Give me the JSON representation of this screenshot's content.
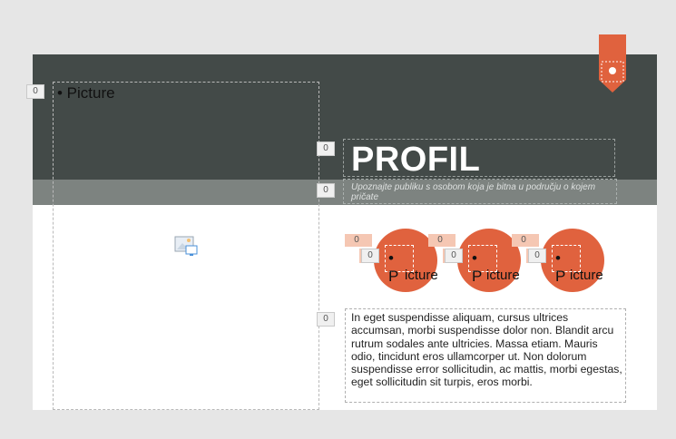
{
  "slide": {
    "picture_placeholder_label": "• Picture",
    "title": "PROFIL",
    "subtitle": "Upoznajte publiku s osobom koja je bitna u području o kojem pričate",
    "body": "In eget suspendisse aliquam, cursus ultrices accumsan, morbi suspendisse dolor non. Blandit arcu rutrum sodales ante ultricies. Massa etiam. Mauris odio, tincidunt eros ullamcorper ut. Non dolorum suspendisse error sollicitudin, ac mattis, morbi egestas, eget sollicitudin sit turpis, eros morbi.",
    "circle_label": "• P",
    "circle_vertical": "icture",
    "tags": {
      "picture": "0",
      "title": "0",
      "subtitle": "0",
      "body": "0",
      "c1a": "0",
      "c1b": "0",
      "c2a": "0",
      "c2b": "0",
      "c3a": "0",
      "c3b": "0"
    }
  },
  "colors": {
    "dark_band": "#434a48",
    "mid_band": "#7d8380",
    "accent": "#e0623e",
    "peach": "#f5c7b3"
  },
  "icons": [
    "picture-icon",
    "bookmark-icon"
  ]
}
